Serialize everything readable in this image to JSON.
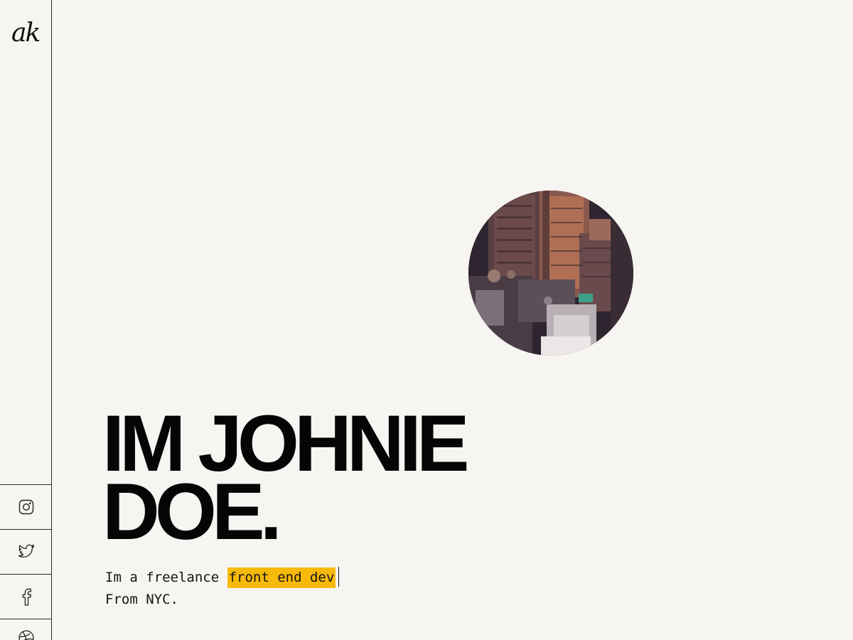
{
  "sidebar": {
    "logo_text": "ak",
    "social": [
      {
        "name": "instagram-icon"
      },
      {
        "name": "twitter-icon"
      },
      {
        "name": "facebook-icon"
      },
      {
        "name": "dribbble-icon"
      }
    ]
  },
  "hero": {
    "headline_line1": "IM JOHNIE",
    "headline_line2": "DOE.",
    "tagline_prefix": "Im a freelance ",
    "tagline_highlight": "front end dev",
    "tagline_line2": "From NYC.",
    "highlight_color": "#f7b90a",
    "background_color": "#f6f5f1",
    "profile_image": "city-aerial-photo"
  }
}
